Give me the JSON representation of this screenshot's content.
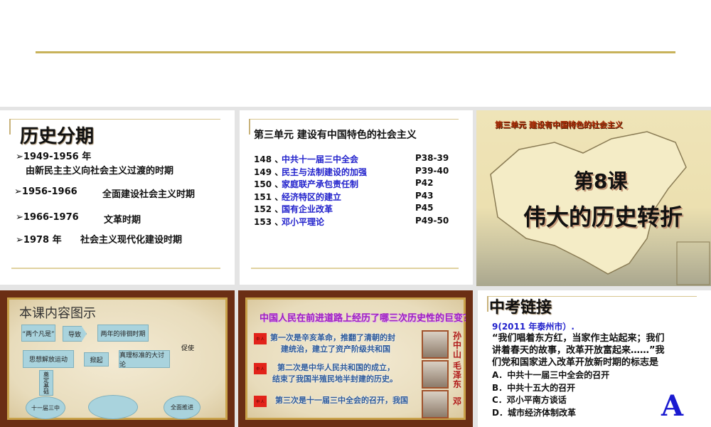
{
  "slide1": {
    "title": "历史分期",
    "items": [
      {
        "years": "1949-1956 年",
        "desc": "由新民主主义向社会主义过渡的时期"
      },
      {
        "years": "1956-1966",
        "desc": "全面建设社会主义时期"
      },
      {
        "years": "1966-1976",
        "desc": "文革时期"
      },
      {
        "years": "1978 年",
        "desc": "社会主义现代化建设时期"
      }
    ]
  },
  "slide2": {
    "title": "第三单元  建设有中国特色的社会主义",
    "rows": [
      {
        "num": "148 、",
        "topic": "中共十一届三中全会",
        "page": "P38-39"
      },
      {
        "num": "149 、",
        "topic": "民主与法制建设的加强",
        "page": "P39-40"
      },
      {
        "num": "150 、",
        "topic": "家庭联产承包责任制",
        "page": "P42"
      },
      {
        "num": "151 、",
        "topic": "经济特区的建立",
        "page": "P43"
      },
      {
        "num": "152 、",
        "topic": "国有企业改革",
        "page": "P45"
      },
      {
        "num": "153 、",
        "topic": "邓小平理论",
        "page": "P49-50"
      }
    ]
  },
  "slide3": {
    "unit": "第三单元  建设有中国特色的社会主义",
    "lesson": "第8课",
    "title": "伟大的历史转折"
  },
  "slide4": {
    "title": "本课内容图示",
    "nodes": {
      "a": "“两个凡是”",
      "arrow1": "导致",
      "b": "两年的徘徊时期",
      "curve": "促使",
      "c": "真理标准的大讨论",
      "arrow2": "掀起",
      "d": "思想解放运动",
      "down": "奠定基础",
      "e": "十一届三中",
      "f": "全面推进"
    }
  },
  "slide5": {
    "title": "中国人民在前进道路上经历了哪三次历史性的巨变？",
    "items": [
      {
        "text1": "第一次是辛亥革命，推翻了清朝的封",
        "text2": "建统治，建立了资产阶级共和国",
        "name": "孙中山"
      },
      {
        "text1": "第二次是中华人民共和国的成立，",
        "text2": "结束了我国半殖民地半封建的历史。",
        "name": "毛泽东"
      },
      {
        "text1": "第三次是十一届三中全会的召开，我国",
        "text2": "",
        "name": "邓"
      }
    ],
    "badge": "中 人"
  },
  "slide6": {
    "title": "中考链接",
    "source": "9(2011 年泰州市）.",
    "question": [
      "“我们唱着东方红，当家作主站起来；我们",
      "讲着春天的故事，改革开放富起来……”我",
      "们党和国家进入改革开放新时期的标志是"
    ],
    "options": [
      "A．中共十一届三中全会的召开",
      "B．中共十五大的召开",
      "C．邓小平南方谈话",
      "D．城市经济体制改革"
    ],
    "answer": "A"
  }
}
